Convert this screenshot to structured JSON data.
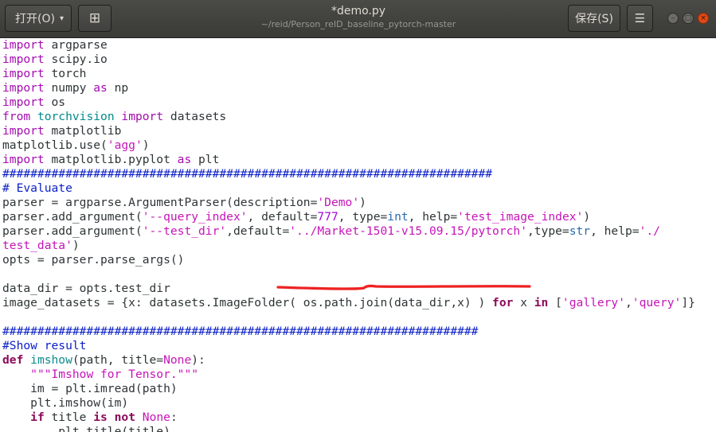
{
  "header": {
    "open_label": "打开(O)",
    "open_caret": "▾",
    "new_tab_icon": "⊞",
    "title": "*demo.py",
    "subtitle": "~/reid/Person_reID_baseline_pytorch-master",
    "save_label": "保存(S)",
    "menu_icon": "☰",
    "minimize_glyph": "–",
    "maximize_glyph": "□",
    "close_glyph": "×"
  },
  "colors": {
    "keyword": "#a40bb0",
    "string": "#c515b8",
    "comment": "#0a1ec6",
    "module": "#008b8b",
    "annotation": "#ee2222"
  },
  "editor": {
    "lines": [
      [
        {
          "t": "import",
          "c": "kw"
        },
        {
          "t": " argparse",
          "c": "pl"
        }
      ],
      [
        {
          "t": "import",
          "c": "kw"
        },
        {
          "t": " scipy.io",
          "c": "pl"
        }
      ],
      [
        {
          "t": "import",
          "c": "kw"
        },
        {
          "t": " torch",
          "c": "pl"
        }
      ],
      [
        {
          "t": "import",
          "c": "kw"
        },
        {
          "t": " numpy ",
          "c": "pl"
        },
        {
          "t": "as",
          "c": "kw"
        },
        {
          "t": " np",
          "c": "pl"
        }
      ],
      [
        {
          "t": "import",
          "c": "kw"
        },
        {
          "t": " os",
          "c": "pl"
        }
      ],
      [
        {
          "t": "from",
          "c": "kw"
        },
        {
          "t": " ",
          "c": "pl"
        },
        {
          "t": "torchvision",
          "c": "mod"
        },
        {
          "t": " ",
          "c": "pl"
        },
        {
          "t": "import",
          "c": "kw"
        },
        {
          "t": " datasets",
          "c": "pl"
        }
      ],
      [
        {
          "t": "import",
          "c": "kw"
        },
        {
          "t": " matplotlib",
          "c": "pl"
        }
      ],
      [
        {
          "t": "matplotlib.use(",
          "c": "pl"
        },
        {
          "t": "'agg'",
          "c": "str"
        },
        {
          "t": ")",
          "c": "pl"
        }
      ],
      [
        {
          "t": "import",
          "c": "kw"
        },
        {
          "t": " matplotlib.pyplot ",
          "c": "pl"
        },
        {
          "t": "as",
          "c": "kw"
        },
        {
          "t": " plt",
          "c": "pl"
        }
      ],
      [
        {
          "t": "######################################################################",
          "c": "cmt"
        }
      ],
      [
        {
          "t": "# Evaluate",
          "c": "cmt"
        }
      ],
      [
        {
          "t": "parser = argparse.ArgumentParser(description=",
          "c": "pl"
        },
        {
          "t": "'Demo'",
          "c": "str"
        },
        {
          "t": ")",
          "c": "pl"
        }
      ],
      [
        {
          "t": "parser.add_argument(",
          "c": "pl"
        },
        {
          "t": "'--query_index'",
          "c": "str"
        },
        {
          "t": ", default=",
          "c": "pl"
        },
        {
          "t": "777",
          "c": "num"
        },
        {
          "t": ", type=",
          "c": "pl"
        },
        {
          "t": "int",
          "c": "bi"
        },
        {
          "t": ", help=",
          "c": "pl"
        },
        {
          "t": "'test_image_index'",
          "c": "str"
        },
        {
          "t": ")",
          "c": "pl"
        }
      ],
      [
        {
          "t": "parser.add_argument(",
          "c": "pl"
        },
        {
          "t": "'--test_dir'",
          "c": "str"
        },
        {
          "t": ",default=",
          "c": "pl"
        },
        {
          "t": "'../Market-1501-v15.09.15/pytorch'",
          "c": "str"
        },
        {
          "t": ",type=",
          "c": "pl"
        },
        {
          "t": "str",
          "c": "bi"
        },
        {
          "t": ", help=",
          "c": "pl"
        },
        {
          "t": "'./",
          "c": "str"
        }
      ],
      [
        {
          "t": "test_data'",
          "c": "str"
        },
        {
          "t": ")",
          "c": "pl"
        }
      ],
      [
        {
          "t": "opts = parser.parse_args()",
          "c": "pl"
        }
      ],
      [
        {
          "t": "",
          "c": "pl"
        }
      ],
      [
        {
          "t": "data_dir = opts.test_dir",
          "c": "pl"
        }
      ],
      [
        {
          "t": "image_datasets = {x: datasets.ImageFolder( os.path.join(data_dir,x) ) ",
          "c": "pl"
        },
        {
          "t": "for",
          "c": "kwb"
        },
        {
          "t": " x ",
          "c": "pl"
        },
        {
          "t": "in",
          "c": "kwb"
        },
        {
          "t": " [",
          "c": "pl"
        },
        {
          "t": "'gallery'",
          "c": "str"
        },
        {
          "t": ",",
          "c": "pl"
        },
        {
          "t": "'query'",
          "c": "str"
        },
        {
          "t": "]}",
          "c": "pl"
        }
      ],
      [
        {
          "t": "",
          "c": "pl"
        }
      ],
      [
        {
          "t": "####################################################################",
          "c": "cmt"
        }
      ],
      [
        {
          "t": "#Show result",
          "c": "cmt"
        }
      ],
      [
        {
          "t": "def",
          "c": "kwb"
        },
        {
          "t": " ",
          "c": "pl"
        },
        {
          "t": "imshow",
          "c": "def"
        },
        {
          "t": "(path, title=",
          "c": "pl"
        },
        {
          "t": "None",
          "c": "const"
        },
        {
          "t": "):",
          "c": "pl"
        }
      ],
      [
        {
          "t": "    ",
          "c": "pl"
        },
        {
          "t": "\"\"\"Imshow for Tensor.\"\"\"",
          "c": "str"
        }
      ],
      [
        {
          "t": "    im = plt.imread(path)",
          "c": "pl"
        }
      ],
      [
        {
          "t": "    plt.imshow(im)",
          "c": "pl"
        }
      ],
      [
        {
          "t": "    ",
          "c": "pl"
        },
        {
          "t": "if",
          "c": "kwb"
        },
        {
          "t": " title ",
          "c": "pl"
        },
        {
          "t": "is",
          "c": "kwb"
        },
        {
          "t": " ",
          "c": "pl"
        },
        {
          "t": "not",
          "c": "kwb"
        },
        {
          "t": " ",
          "c": "pl"
        },
        {
          "t": "None",
          "c": "const"
        },
        {
          "t": ":",
          "c": "pl"
        }
      ],
      [
        {
          "t": "        plt.title(title)",
          "c": "pl"
        }
      ]
    ]
  }
}
